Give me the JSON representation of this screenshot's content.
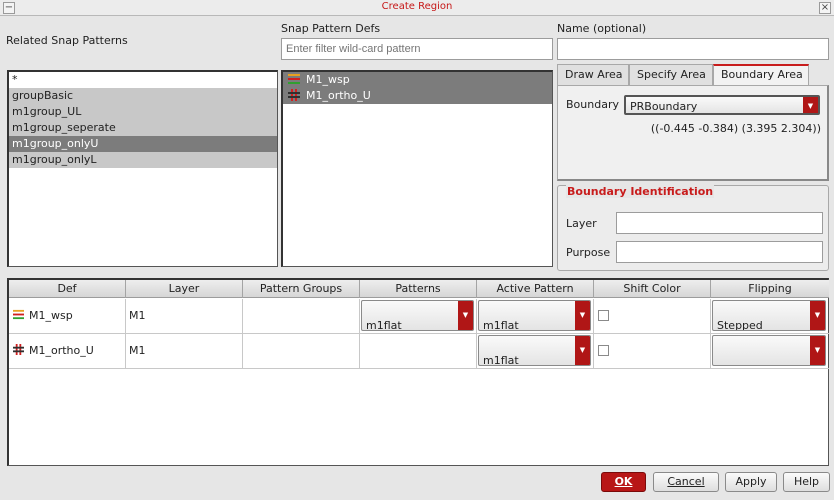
{
  "window": {
    "title": "Create Region",
    "left_button": "−",
    "right_button": "×"
  },
  "related_snap_patterns": {
    "label": "Related Snap Patterns",
    "items": [
      "*",
      "groupBasic",
      "m1group_UL",
      "m1group_seperate",
      "m1group_onlyU",
      "m1group_onlyL"
    ]
  },
  "snap_pattern_defs": {
    "label": "Snap Pattern Defs",
    "filter_placeholder": "Enter filter wild-card pattern",
    "items": [
      {
        "name": "M1_wsp",
        "icon": "stripe-pattern-icon"
      },
      {
        "name": "M1_ortho_U",
        "icon": "hash-pattern-icon"
      }
    ]
  },
  "name_field": {
    "label": "Name (optional)",
    "value": ""
  },
  "tabs": [
    "Draw Area",
    "Specify Area",
    "Boundary Area"
  ],
  "boundary": {
    "label": "Boundary",
    "value": "PRBoundary",
    "coords": "((-0.445 -0.384) (3.395 2.304))"
  },
  "boundary_identification": {
    "title": "Boundary Identification",
    "layer_label": "Layer",
    "layer_value": "",
    "purpose_label": "Purpose",
    "purpose_value": ""
  },
  "table": {
    "columns": [
      "Def",
      "Layer",
      "Pattern Groups",
      "Patterns",
      "Active Pattern",
      "Shift Color",
      "Flipping"
    ],
    "rows": [
      {
        "def": "M1_wsp",
        "layer": "M1",
        "pattern_groups": "",
        "patterns": "m1flat",
        "active_pattern": "m1flat",
        "shift_color": false,
        "flipping": "Stepped"
      },
      {
        "def": "M1_ortho_U",
        "layer": "M1",
        "pattern_groups": "",
        "patterns": "",
        "active_pattern": "m1flat",
        "shift_color": false,
        "flipping": ""
      }
    ]
  },
  "buttons": {
    "ok": "OK",
    "cancel": "Cancel",
    "apply": "Apply",
    "help": "Help"
  },
  "colors": {
    "accent": "#b81616",
    "selection": "#c8c8c8",
    "highlight": "#7c7c7c"
  }
}
